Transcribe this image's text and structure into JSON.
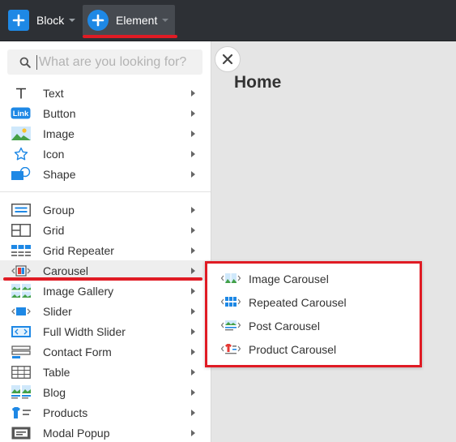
{
  "toolbar": {
    "block_label": "Block",
    "element_label": "Element"
  },
  "search": {
    "placeholder": "What are you looking for?",
    "value": ""
  },
  "menu": {
    "items": [
      {
        "label": "Text",
        "icon": "text-icon"
      },
      {
        "label": "Button",
        "icon": "link-button-icon",
        "icon_text": "Link"
      },
      {
        "label": "Image",
        "icon": "image-icon"
      },
      {
        "label": "Icon",
        "icon": "star-icon"
      },
      {
        "label": "Shape",
        "icon": "shape-icon"
      },
      {
        "label": "Group",
        "icon": "group-icon"
      },
      {
        "label": "Grid",
        "icon": "grid-icon"
      },
      {
        "label": "Grid Repeater",
        "icon": "grid-repeater-icon"
      },
      {
        "label": "Carousel",
        "icon": "carousel-icon",
        "active": true
      },
      {
        "label": "Image Gallery",
        "icon": "image-gallery-icon"
      },
      {
        "label": "Slider",
        "icon": "slider-icon"
      },
      {
        "label": "Full Width Slider",
        "icon": "full-width-slider-icon"
      },
      {
        "label": "Contact Form",
        "icon": "contact-form-icon"
      },
      {
        "label": "Table",
        "icon": "table-icon"
      },
      {
        "label": "Blog",
        "icon": "blog-icon"
      },
      {
        "label": "Products",
        "icon": "products-icon"
      },
      {
        "label": "Modal Popup",
        "icon": "modal-popup-icon"
      }
    ]
  },
  "canvas": {
    "page_title": "Home"
  },
  "submenu": {
    "items": [
      {
        "label": "Image Carousel",
        "icon": "image-carousel-icon"
      },
      {
        "label": "Repeated Carousel",
        "icon": "repeated-carousel-icon"
      },
      {
        "label": "Post Carousel",
        "icon": "post-carousel-icon"
      },
      {
        "label": "Product Carousel",
        "icon": "product-carousel-icon"
      }
    ]
  },
  "colors": {
    "toolbar_bg": "#2d3035",
    "accent_blue": "#1e88e5",
    "highlight_red": "#e01b24",
    "canvas_bg": "#e5e5e5"
  }
}
